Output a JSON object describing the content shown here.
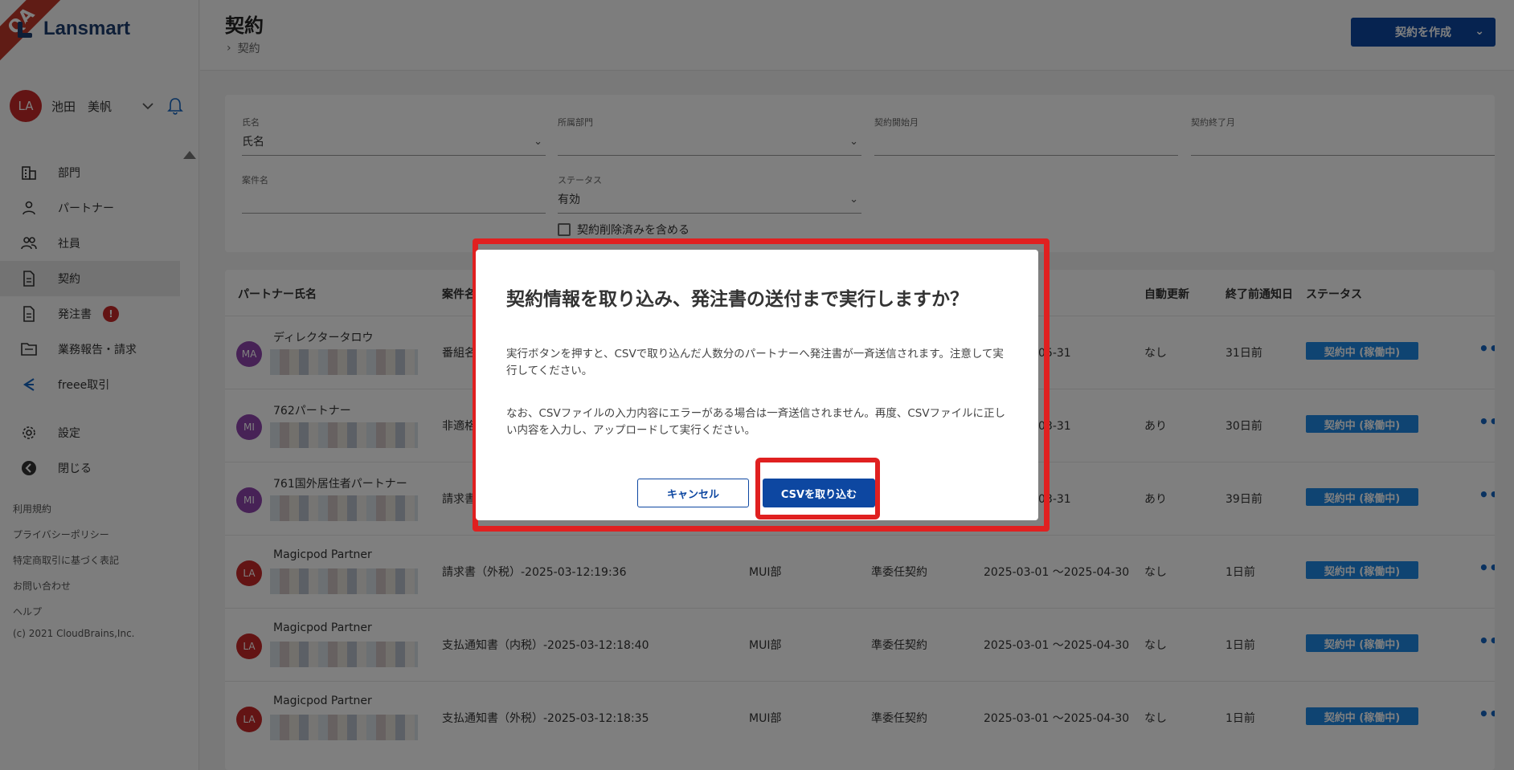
{
  "ribbon": "QA",
  "brand": "Lansmart",
  "user": {
    "initials": "LA",
    "name": "池田　美帆"
  },
  "nav": [
    {
      "label": "部門",
      "icon": "building-icon"
    },
    {
      "label": "パートナー",
      "icon": "person-icon"
    },
    {
      "label": "社員",
      "icon": "people-icon"
    },
    {
      "label": "契約",
      "icon": "document-icon"
    },
    {
      "label": "発注書",
      "icon": "document-icon",
      "badge": "!"
    },
    {
      "label": "業務報告・請求",
      "icon": "folder-icon"
    },
    {
      "label": "freee取引",
      "icon": "freee-icon"
    },
    {
      "label": "設定",
      "icon": "gear-icon"
    },
    {
      "label": "閉じる",
      "icon": "back-icon"
    }
  ],
  "footer": [
    "利用規約",
    "プライバシーポリシー",
    "特定商取引に基づく表記",
    "お問い合わせ",
    "ヘルプ"
  ],
  "copyright": "(c) 2021 CloudBrains,Inc.",
  "header": {
    "title": "契約",
    "breadcrumb": "契約",
    "create_label": "契約を作成"
  },
  "filters": {
    "name_label": "氏名",
    "name_value": "氏名",
    "dept_label": "所属部門",
    "dept_value": "",
    "start_label": "契約開始月",
    "start_value": "",
    "end_label": "契約終了月",
    "end_value": "",
    "project_label": "案件名",
    "project_value": "",
    "status_label": "ステータス",
    "status_value": "有効",
    "include_deleted": "契約削除済みを含める"
  },
  "table": {
    "headers": {
      "partner": "パートナー氏名",
      "project": "案件名",
      "auto": "自動更新",
      "notice": "終了前通知日",
      "status": "ステータス"
    },
    "rows": [
      {
        "initials": "MA",
        "color": "#8e44ad",
        "name": "ディレクタータロウ",
        "project": "番組名",
        "dept": "",
        "type": "",
        "period": "1 ～2025-05-31",
        "auto": "なし",
        "notice": "31日前",
        "status": "契約中 (稼働中)"
      },
      {
        "initials": "MI",
        "color": "#8e44ad",
        "name": "762パートナー",
        "project": "非適格",
        "dept": "",
        "type": "",
        "period": "1 ～2025-03-31",
        "auto": "あり",
        "notice": "30日前",
        "status": "契約中 (稼働中)"
      },
      {
        "initials": "MI",
        "color": "#8e44ad",
        "name": "761国外居住者パートナー",
        "project": "請求書",
        "dept": "",
        "type": "",
        "period": "1 ～2025-03-31",
        "auto": "あり",
        "notice": "39日前",
        "status": "契約中 (稼働中)"
      },
      {
        "initials": "LA",
        "color": "#c62828",
        "name": "Magicpod Partner",
        "project": "請求書（外税）-2025-03-12:19:36",
        "dept": "MUI部",
        "type": "準委任契約",
        "period": "2025-03-01 ～2025-04-30",
        "auto": "なし",
        "notice": "1日前",
        "status": "契約中 (稼働中)"
      },
      {
        "initials": "LA",
        "color": "#c62828",
        "name": "Magicpod Partner",
        "project": "支払通知書（内税）-2025-03-12:18:40",
        "dept": "MUI部",
        "type": "準委任契約",
        "period": "2025-03-01 ～2025-04-30",
        "auto": "なし",
        "notice": "1日前",
        "status": "契約中 (稼働中)"
      },
      {
        "initials": "LA",
        "color": "#c62828",
        "name": "Magicpod Partner",
        "project": "支払通知書（外税）-2025-03-12:18:35",
        "dept": "MUI部",
        "type": "準委任契約",
        "period": "2025-03-01 ～2025-04-30",
        "auto": "なし",
        "notice": "1日前",
        "status": "契約中 (稼働中)"
      }
    ]
  },
  "modal": {
    "title": "契約情報を取り込み、発注書の送付まで実行しますか？",
    "p1": "実行ボタンを押すと、CSVで取り込んだ人数分のパートナーへ発注書が一斉送信されます。注意して実行してください。",
    "p2": "なお、CSVファイルの入力内容にエラーがある場合は一斉送信されません。再度、CSVファイルに正しい内容を入力し、アップロードして実行ください。",
    "cancel": "キャンセル",
    "import": "CSVを取り込む"
  },
  "colors": {
    "primary": "#0d47a1",
    "status": "#1e88e5",
    "highlight": "#e02020"
  }
}
